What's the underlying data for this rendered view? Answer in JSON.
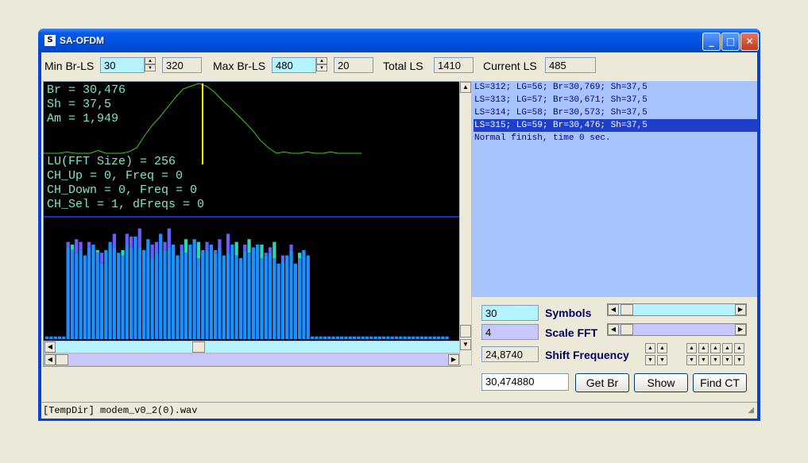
{
  "window": {
    "title": "SA-OFDM"
  },
  "top": {
    "min_label": "Min Br-LS",
    "min_value": "30",
    "min_aux": "320",
    "max_label": "Max Br-LS",
    "max_value": "480",
    "max_aux": "20",
    "total_label": "Total LS",
    "total_value": "1410",
    "current_label": "Current LS",
    "current_value": "485"
  },
  "spectrum_info": {
    "br": "Br = 30,476",
    "sh": "Sh = 37,5",
    "am": "Am = 1,949",
    "lu": "LU(FFT Size) = 256",
    "ch_up": "CH_Up = 0, Freq = 0",
    "ch_down": "CH_Down = 0, Freq = 0",
    "ch_sel": "CH_Sel = 1, dFreqs = 0"
  },
  "log": [
    "LS=312; LG=56; Br=30,769; Sh=37,5",
    "LS=313; LG=57; Br=30,671; Sh=37,5",
    "LS=314; LG=58; Br=30,573; Sh=37,5",
    "LS=315; LG=59; Br=30,476; Sh=37,5",
    "Normal finish, time 0 sec."
  ],
  "controls": {
    "symbols_value": "30",
    "symbols_label": "Symbols",
    "scale_value": "4",
    "scale_label": "Scale FFT",
    "shift_value": "24,8740",
    "shift_label": "Shift Frequency",
    "result_value": "30,474880",
    "getbr_label": "Get Br",
    "show_label": "Show",
    "findct_label": "Find CT"
  },
  "status": {
    "text": "[TempDir] modem_v0_2(0).wav"
  },
  "colors": {
    "correlation_line": "#44cc22",
    "marker": "#ffff00",
    "bar_a": "#1e8fff",
    "bar_b": "#6a5cff",
    "bar_c": "#2ad8b0"
  },
  "chart_data": {
    "type": "bar",
    "description_free": true,
    "values": [
      0.02,
      0.02,
      0.02,
      0.02,
      0.02,
      0.68,
      0.66,
      0.64,
      0.66,
      0.62,
      0.68,
      0.7,
      0.64,
      0.56,
      0.66,
      0.72,
      0.68,
      0.64,
      0.62,
      0.7,
      0.68,
      0.76,
      0.68,
      0.66,
      0.74,
      0.6,
      0.64,
      0.78,
      0.66,
      0.68,
      0.7,
      0.62,
      0.66,
      0.64,
      0.7,
      0.74,
      0.6,
      0.66,
      0.66,
      0.7,
      0.64,
      0.68,
      0.62,
      0.64,
      0.7,
      0.62,
      0.6,
      0.66,
      0.64,
      0.68,
      0.7,
      0.6,
      0.62,
      0.64,
      0.6,
      0.56,
      0.58,
      0.62,
      0.66,
      0.56,
      0.6,
      0.66,
      0.62,
      0.02,
      0.02,
      0.02,
      0.02,
      0.02,
      0.02,
      0.02,
      0.02,
      0.02,
      0.02,
      0.02,
      0.02,
      0.02,
      0.02,
      0.02,
      0.02,
      0.02,
      0.02,
      0.02,
      0.02,
      0.02,
      0.02,
      0.02,
      0.02,
      0.02,
      0.02,
      0.02,
      0.02,
      0.02,
      0.02,
      0.02,
      0.02,
      0.02
    ],
    "overlay": [
      0,
      0,
      0,
      0,
      0,
      0.04,
      0.04,
      0.1,
      0.06,
      0.0,
      0.04,
      0.0,
      0.02,
      0.08,
      0.0,
      0.0,
      0.1,
      0.0,
      0.04,
      0.08,
      0.08,
      0.0,
      0.14,
      0.0,
      0.0,
      0.1,
      0.08,
      0.0,
      0.06,
      0.14,
      0.0,
      0.0,
      0.04,
      0.1,
      0.0,
      0.0,
      0.12,
      0.0,
      0.06,
      0.0,
      0.02,
      0.06,
      0.0,
      0.14,
      0.0,
      0.1,
      0.0,
      0.04,
      0.1,
      0.0,
      0.0,
      0.1,
      0.02,
      0.04,
      0.12,
      0.0,
      0.04,
      0.0,
      0.04,
      0.0,
      0.04,
      0.0,
      0.0
    ],
    "correlation": [
      0.0,
      0.0,
      0.0,
      0.02,
      0.0,
      0.0,
      0.0,
      0.04,
      0.0,
      0.0,
      0.0,
      0.02,
      0.08,
      0.25,
      0.4,
      0.52,
      0.66,
      0.8,
      0.92,
      0.96,
      1.0,
      0.96,
      0.88,
      0.76,
      0.66,
      0.55,
      0.44,
      0.32,
      0.18,
      0.08,
      0.0,
      0.02,
      0.0,
      0.0,
      0.02,
      0.0,
      0.0,
      0.02,
      0.0,
      0.0,
      0.0,
      0.0
    ]
  }
}
